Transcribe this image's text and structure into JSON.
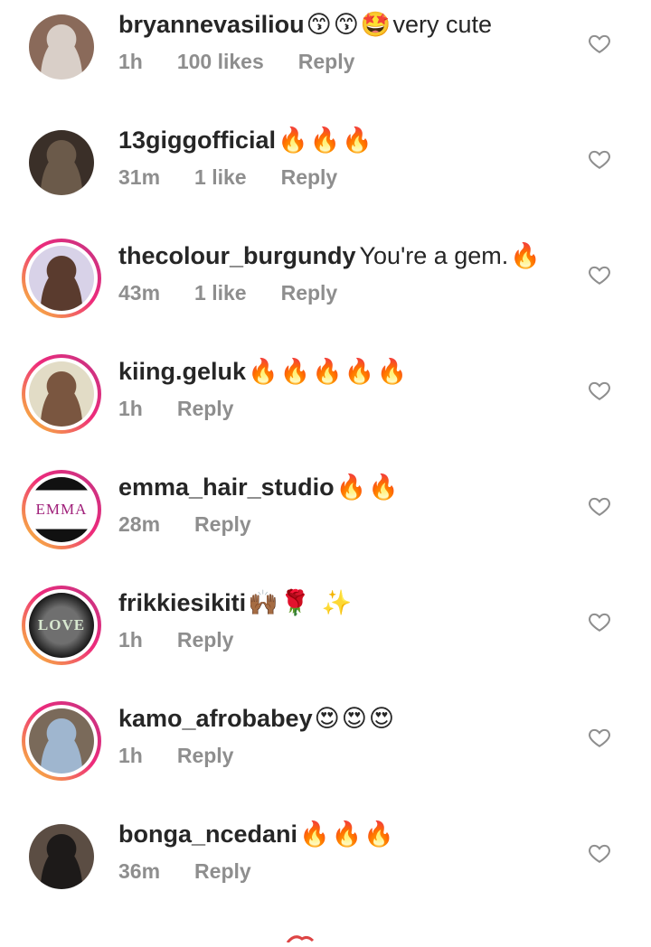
{
  "comments": [
    {
      "username": "bryannevasiliou",
      "text": "very cute",
      "emoji": "😙😙🤩",
      "emoji_position": "before",
      "time": "1h",
      "likes": "100 likes",
      "reply": "Reply",
      "ring": false,
      "avatar_colors": [
        "#8a6a5a",
        "#d9cfc8"
      ]
    },
    {
      "username": "13giggofficial",
      "text": "",
      "emoji": "🔥🔥🔥",
      "emoji_position": "after",
      "time": "31m",
      "likes": "1 like",
      "reply": "Reply",
      "ring": false,
      "avatar_colors": [
        "#3a2f28",
        "#6b5a4a"
      ]
    },
    {
      "username": "thecolour_burgundy",
      "text": "You're a gem.",
      "emoji": "🔥",
      "emoji_position": "after",
      "time": "43m",
      "likes": "1 like",
      "reply": "Reply",
      "ring": true,
      "avatar_colors": [
        "#d8d2e8",
        "#5a3b2e"
      ]
    },
    {
      "username": "kiing.geluk",
      "text": "",
      "emoji": "🔥🔥🔥🔥🔥",
      "emoji_position": "after",
      "time": "1h",
      "likes": "",
      "reply": "Reply",
      "ring": true,
      "avatar_colors": [
        "#e2dcc6",
        "#7a5640"
      ]
    },
    {
      "username": "emma_hair_studio",
      "text": "",
      "emoji": "🔥🔥",
      "emoji_position": "after",
      "time": "28m",
      "likes": "",
      "reply": "Reply",
      "ring": true,
      "avatar_colors": [
        "#ffffff",
        "#111111"
      ],
      "avatar_label": "EMMA"
    },
    {
      "username": "frikkiesikiti",
      "text": "",
      "emoji": "🙌🏾🌹 ✨",
      "emoji_position": "after",
      "time": "1h",
      "likes": "",
      "reply": "Reply",
      "ring": true,
      "avatar_colors": [
        "#1a1a1a",
        "#6f6f6f"
      ],
      "avatar_label": "LOVE"
    },
    {
      "username": "kamo_afrobabey",
      "text": "",
      "emoji": "😍😍😍",
      "emoji_position": "after",
      "time": "1h",
      "likes": "",
      "reply": "Reply",
      "ring": true,
      "avatar_colors": [
        "#7a6a5a",
        "#9fb6cf"
      ]
    },
    {
      "username": "bonga_ncedani",
      "text": "",
      "emoji": "🔥🔥🔥",
      "emoji_position": "after",
      "time": "36m",
      "likes": "",
      "reply": "Reply",
      "ring": false,
      "avatar_colors": [
        "#5b4d43",
        "#1d1a19"
      ]
    }
  ],
  "colors": {
    "username": "#262626",
    "meta": "#8e8e8e",
    "heart": "#8e8e8e",
    "ring_start": "#f9ce34",
    "ring_end": "#c13584"
  },
  "icons": {
    "heart": "heart-outline-icon"
  }
}
